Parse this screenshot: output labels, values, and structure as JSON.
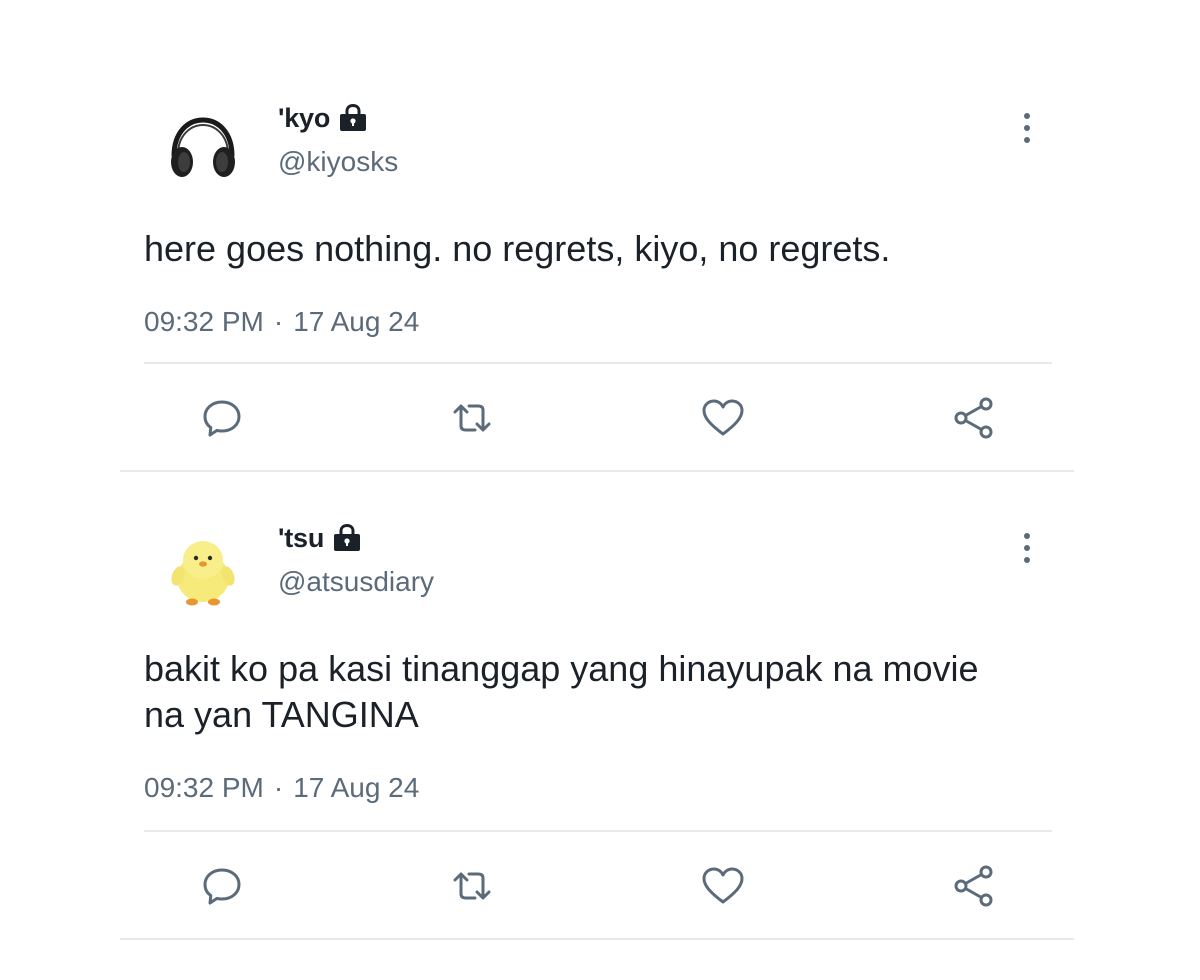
{
  "tweets": [
    {
      "display_name": "'kyo",
      "handle": "@kiyosks",
      "text": "here goes nothing. no regrets, kiyo, no regrets.",
      "time": "09:32 PM",
      "separator": "·",
      "date": "17 Aug 24",
      "avatar_icon": "headphones-icon"
    },
    {
      "display_name": "'tsu",
      "handle": "@atsusdiary",
      "text": "bakit ko pa kasi tinanggap yang hinayupak na movie na yan TANGINA",
      "time": "09:32 PM",
      "separator": "·",
      "date": "17 Aug 24",
      "avatar_icon": "chick-plush-icon"
    }
  ],
  "icons": {
    "badge": "lock-icon",
    "menu": "more-vertical-icon",
    "actions": [
      "reply-icon",
      "retweet-icon",
      "like-icon",
      "share-icon"
    ]
  },
  "colors": {
    "text_primary": "#1b2128",
    "text_secondary": "#5b6b7a",
    "icon": "#5b6b7a",
    "divider": "#e7eaed"
  }
}
